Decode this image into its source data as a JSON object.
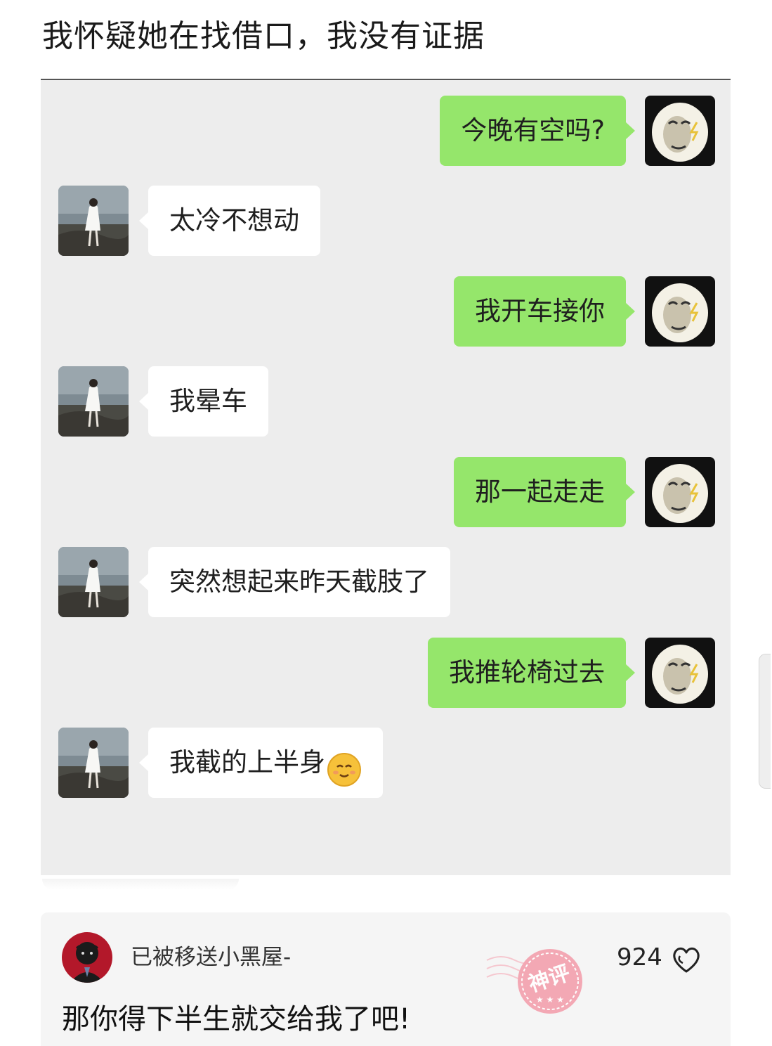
{
  "post": {
    "title": "我怀疑她在找借口，我没有证据"
  },
  "chat": {
    "messages": [
      {
        "side": "out",
        "text": "今晚有空吗?"
      },
      {
        "side": "in",
        "text": "太冷不想动"
      },
      {
        "side": "out",
        "text": "我开车接你"
      },
      {
        "side": "in",
        "text": "我晕车"
      },
      {
        "side": "out",
        "text": "那一起走走"
      },
      {
        "side": "in",
        "text": "突然想起来昨天截肢了"
      },
      {
        "side": "out",
        "text": "我推轮椅过去"
      },
      {
        "side": "in",
        "text": "我截的上半身",
        "emoji": "smiling-face-emoji"
      }
    ],
    "colors": {
      "incoming_bubble": "#ffffff",
      "outgoing_bubble": "#95e66b",
      "background": "#ededed"
    }
  },
  "comment": {
    "username": "已被移送小黑屋-",
    "likes": "924",
    "text": "那你得下半生就交给我了吧!",
    "stamp_text": "神评",
    "stamp_color": "#f3a0ad"
  }
}
